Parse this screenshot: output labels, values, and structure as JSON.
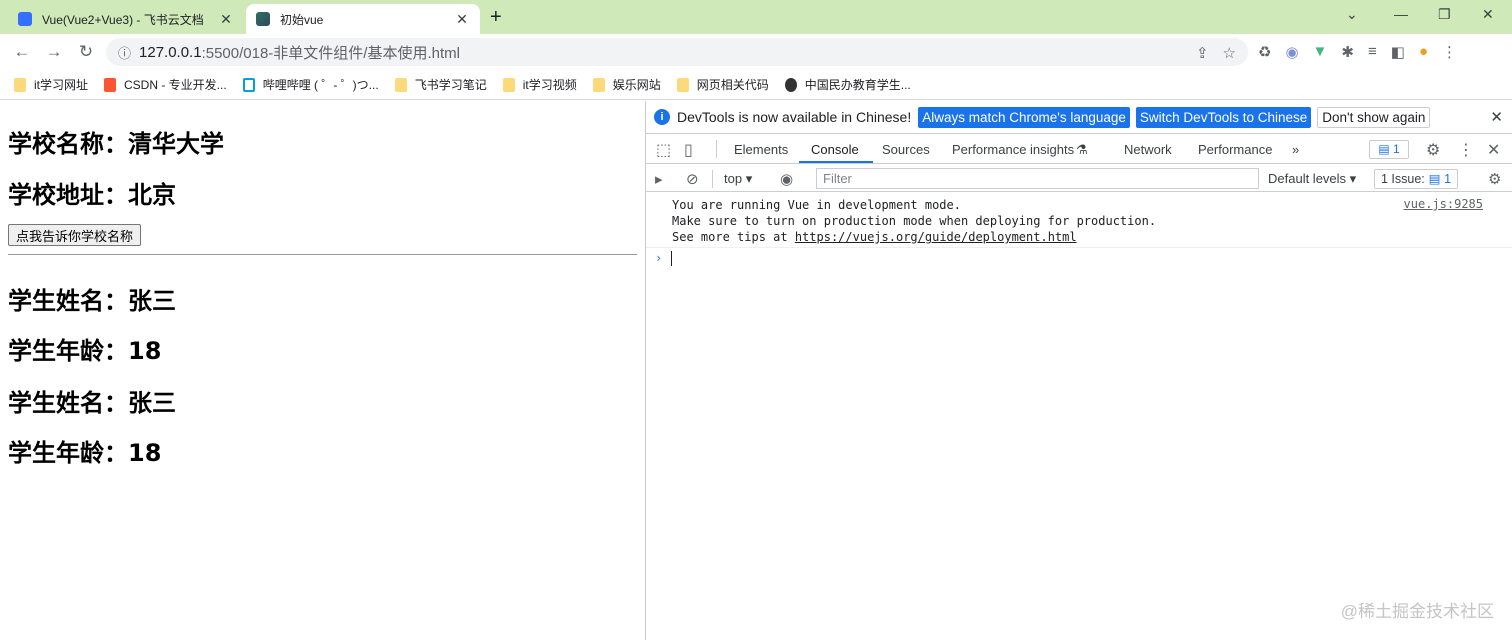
{
  "tabs": [
    {
      "title": "Vue(Vue2+Vue3) - 飞书云文档",
      "active": false
    },
    {
      "title": "初始vue",
      "active": true
    }
  ],
  "new_tab_label": "+",
  "address": {
    "host": "127.0.0.1",
    "path": ":5500/018-非单文件组件/基本使用.html"
  },
  "bookmarks": [
    {
      "label": "it学习网址",
      "icon": "folder-icon"
    },
    {
      "label": "CSDN - 专业开发...",
      "icon": "csdn-icon"
    },
    {
      "label": "哔哩哔哩 ( ゜- ゜)つ...",
      "icon": "bilibili-icon"
    },
    {
      "label": "飞书学习笔记",
      "icon": "folder-icon"
    },
    {
      "label": "it学习视频",
      "icon": "folder-icon"
    },
    {
      "label": "娱乐网站",
      "icon": "folder-icon"
    },
    {
      "label": "网页相关代码",
      "icon": "folder-icon"
    },
    {
      "label": "中国民办教育学生...",
      "icon": "globe-icon"
    }
  ],
  "page": {
    "school_name": "学校名称：清华大学",
    "school_address": "学校地址：北京",
    "button_label": "点我告诉你学校名称",
    "student_blocks": [
      {
        "name": "学生姓名：张三",
        "age": "学生年龄：18"
      },
      {
        "name": "学生姓名：张三",
        "age": "学生年龄：18"
      }
    ],
    "watermark": "@稀土掘金技术社区"
  },
  "devtools": {
    "infobar": {
      "message": "DevTools is now available in Chinese!",
      "btn_match": "Always match Chrome's language",
      "btn_switch": "Switch DevTools to Chinese",
      "btn_dismiss": "Don't show again"
    },
    "tabs": [
      "Elements",
      "Console",
      "Sources",
      "Performance insights",
      "Network",
      "Performance"
    ],
    "selected_tab": "Console",
    "more_tabs": "»",
    "message_count": "1",
    "context": "top",
    "filter_placeholder": "Filter",
    "levels": "Default levels",
    "issues_label": "1 Issue:",
    "issues_count": "1",
    "log": {
      "line1": "You are running Vue in development mode.",
      "line2": "Make sure to turn on production mode when deploying for production.",
      "line3_prefix": "See more tips at ",
      "line3_link": "https://vuejs.org/guide/deployment.html",
      "source": "vue.js:9285"
    },
    "prompt": "›"
  },
  "colors": {
    "tabstrip": "#cfe9b9",
    "accent": "#1a73e8"
  }
}
